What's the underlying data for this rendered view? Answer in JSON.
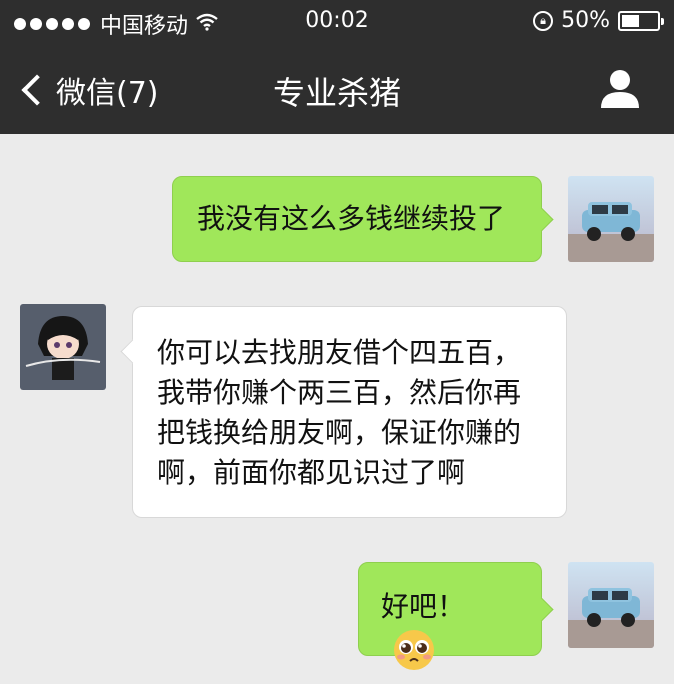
{
  "status_bar": {
    "carrier": "中国移动",
    "time": "00:02",
    "battery": "50%",
    "battery_level": 0.5,
    "icons": [
      "signal-dots-icon",
      "wifi-icon",
      "rotation-lock-icon",
      "battery-icon"
    ]
  },
  "nav": {
    "back_label": "微信(7)",
    "title": "专业杀猪",
    "icons": [
      "chevron-left-icon",
      "profile-icon"
    ]
  },
  "messages": [
    {
      "direction": "outgoing",
      "text": "我没有这么多钱继续投了",
      "avatar": "car-avatar"
    },
    {
      "direction": "incoming",
      "lines": [
        "你可以去找朋友借个四五百，",
        "我带你赚个两三百，然后你再",
        "把钱换给朋友啊，保证你赚的",
        "啊，前面你都见识过了啊"
      ],
      "avatar": "anime-avatar"
    },
    {
      "direction": "outgoing",
      "text": "好吧！",
      "emoji": "pleading-face-emoji",
      "avatar": "car-avatar"
    }
  ],
  "colors": {
    "nav_bg": "#2e2e2e",
    "chat_bg": "#ebebeb",
    "outgoing_bubble": "#a0e75a",
    "incoming_bubble": "#ffffff"
  }
}
